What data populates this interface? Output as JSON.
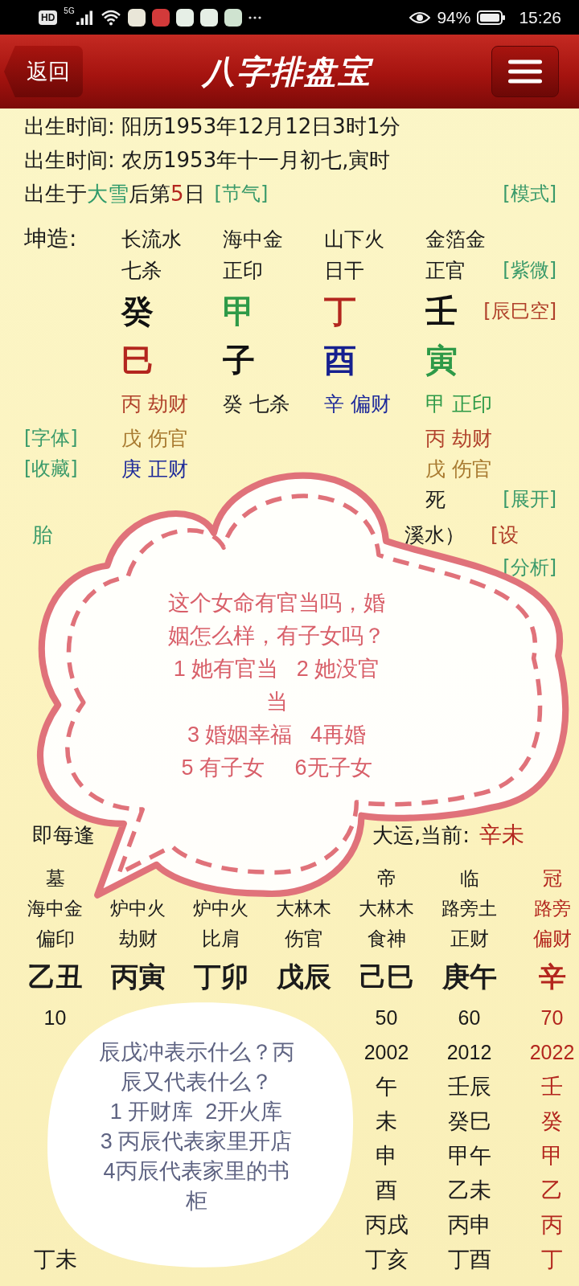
{
  "status_bar": {
    "badge": "HD",
    "network": "5G",
    "battery": "94%",
    "time": "15:26"
  },
  "header": {
    "back": "返回",
    "title": "八字排盘宝"
  },
  "birth_lines": [
    "出生时间: 阳历1953年12月12日3时1分",
    "出生时间: 农历1953年十一月初七,寅时"
  ],
  "solar_term": {
    "parts": [
      {
        "text": "出生于",
        "color": "#1b1b1b"
      },
      {
        "text": "大雪",
        "color": "#2f9a6a"
      },
      {
        "text": "后第",
        "color": "#1b1b1b"
      },
      {
        "text": "5",
        "color": "#b3261e"
      },
      {
        "text": "日",
        "color": "#1b1b1b"
      }
    ],
    "link": "[节气]",
    "mode_link": "[模式]"
  },
  "chart": {
    "label": "坤造:",
    "pillars": [
      {
        "nayin": "长流水",
        "god": "七杀",
        "stem": {
          "text": "癸",
          "color": "#111111"
        },
        "branch": {
          "text": "巳",
          "color": "#b3261e"
        },
        "hidden": [
          {
            "text": "丙 劫财",
            "color": "#b0402a"
          },
          {
            "text": "戊 伤官",
            "color": "#a87a30"
          },
          {
            "text": "庚 正财",
            "color": "#1e2a9a"
          }
        ]
      },
      {
        "nayin": "海中金",
        "god": "正印",
        "stem": {
          "text": "甲",
          "color": "#2e9a48"
        },
        "branch": {
          "text": "子",
          "color": "#111111"
        },
        "hidden": [
          {
            "text": "癸 七杀",
            "color": "#222222"
          }
        ]
      },
      {
        "nayin": "山下火",
        "god": "日干",
        "stem": {
          "text": "丁",
          "color": "#b3261e"
        },
        "branch": {
          "text": "酉",
          "color": "#16208f"
        },
        "hidden": [
          {
            "text": "辛 偏财",
            "color": "#1e2a9a"
          }
        ]
      },
      {
        "nayin": "金箔金",
        "god": "正官",
        "stem": {
          "text": "壬",
          "color": "#111111"
        },
        "branch": {
          "text": "寅",
          "color": "#2e9a48"
        },
        "hidden": [
          {
            "text": "甲 正印",
            "color": "#2e9a48"
          },
          {
            "text": "丙 劫财",
            "color": "#b0402a"
          },
          {
            "text": "戊 伤官",
            "color": "#a87a30"
          }
        ],
        "stage": "死"
      }
    ],
    "links": {
      "ziwei": "[紫微]",
      "void": "[辰巳空]",
      "font": "[字体]",
      "favorite": "[收藏]",
      "expand": "[展开]",
      "analyze": "[分析]"
    }
  },
  "taiyuan": {
    "label": "胎",
    "tail": "溪水）",
    "link": "[设"
  },
  "luck_line": {
    "prefix": "即每逢",
    "text": "大运,当前:",
    "current": "辛未"
  },
  "dayun": [
    {
      "stage": "墓",
      "nayin": "海中金",
      "god": "偏印",
      "pillar": "乙丑",
      "age": "10",
      "annual": [
        "丁未"
      ],
      "current": false
    },
    {
      "nayin": "炉中火",
      "god": "劫财",
      "pillar": "丙寅",
      "current": false
    },
    {
      "nayin": "炉中火",
      "god": "比肩",
      "pillar": "丁卯",
      "current": false
    },
    {
      "nayin": "大林木",
      "god": "伤官",
      "pillar": "戊辰",
      "current": false
    },
    {
      "stage": "帝",
      "nayin": "大林木",
      "god": "食神",
      "pillar": "己巳",
      "age": "50",
      "year": "2002",
      "annual": [
        "午",
        "未",
        "申",
        "酉",
        "丙戌",
        "丁亥"
      ],
      "current": false
    },
    {
      "stage": "临",
      "nayin": "路旁土",
      "god": "正财",
      "pillar": "庚午",
      "age": "60",
      "year": "2012",
      "annual": [
        "壬辰",
        "癸巳",
        "甲午",
        "乙未",
        "丙申",
        "丁酉"
      ],
      "current": false
    },
    {
      "stage": "冠",
      "nayin": "路旁",
      "god": "偏财",
      "pillar": "辛",
      "age": "70",
      "year": "2022",
      "annual": [
        "壬",
        "癸",
        "甲",
        "乙",
        "丙",
        "丁"
      ],
      "current": true
    }
  ],
  "bubbles": [
    {
      "kind": "cloud",
      "lines": [
        "这个女命有官当吗，婚",
        "姻怎么样，有子女吗？",
        "1 她有官当   2 她没官",
        "当",
        "3 婚姻幸福   4再婚",
        "5 有子女     6无子女"
      ]
    },
    {
      "kind": "round",
      "lines": [
        "辰戊冲表示什么？丙",
        "辰又代表什么？",
        "1 开财库  2开火库",
        "3 丙辰代表家里开店",
        "4丙辰代表家里的书",
        "柜"
      ]
    }
  ]
}
